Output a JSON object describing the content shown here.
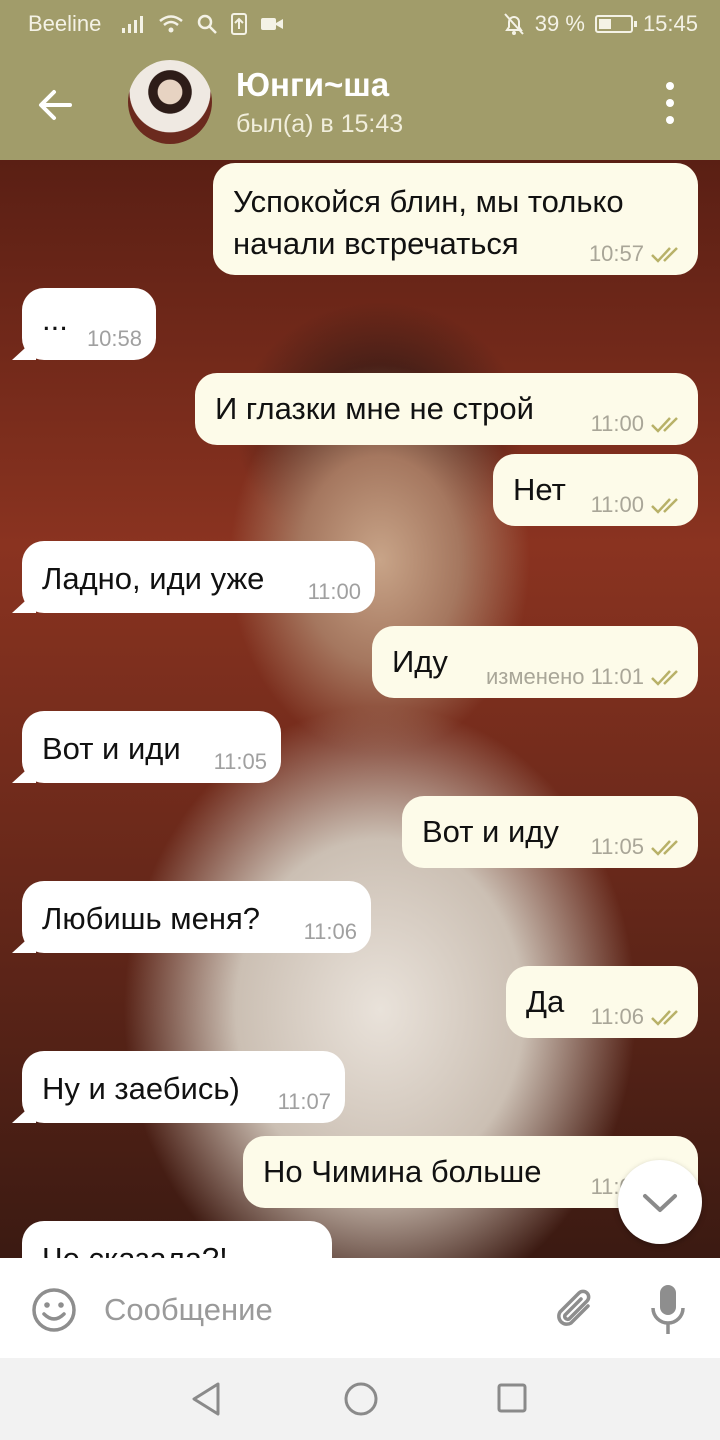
{
  "status_bar": {
    "carrier": "Beeline",
    "battery": "39 %",
    "battery_level": 0.39,
    "time": "15:45"
  },
  "header": {
    "contact_name": "Юнги~ша",
    "last_seen": "был(а) в 15:43"
  },
  "messages": [
    {
      "dir": "out",
      "text": "Успокойся блин, мы только начали встречаться",
      "time": "10:57",
      "read": true
    },
    {
      "dir": "in",
      "text": "...",
      "time": "10:58"
    },
    {
      "dir": "out",
      "text": "И глазки мне не строй",
      "time": "11:00",
      "read": true
    },
    {
      "dir": "out",
      "text": "Нет",
      "time": "11:00",
      "read": true
    },
    {
      "dir": "in",
      "text": "Ладно, иди уже",
      "time": "11:00"
    },
    {
      "dir": "out",
      "text": "Иду",
      "time": "изменено 11:01",
      "read": true
    },
    {
      "dir": "in",
      "text": "Вот и иди",
      "time": "11:05"
    },
    {
      "dir": "out",
      "text": "Вот и иду",
      "time": "11:05",
      "read": true
    },
    {
      "dir": "in",
      "text": "Любишь меня?",
      "time": "11:06"
    },
    {
      "dir": "out",
      "text": "Да",
      "time": "11:06",
      "read": true
    },
    {
      "dir": "in",
      "text": "Ну и заебись)",
      "time": "11:07"
    },
    {
      "dir": "out",
      "text": "Но Чимина больше",
      "time": "11:07",
      "read": true
    },
    {
      "dir": "in",
      "text": "Че сказала?!",
      "time": ""
    }
  ],
  "input": {
    "placeholder": "Сообщение"
  },
  "colors": {
    "header": "#a19c6a",
    "bubble_out": "#fdfbe9",
    "bubble_in": "#ffffff",
    "read_ticks": "#b8b168"
  },
  "icons": [
    "back-arrow-icon",
    "more-vert-icon",
    "emoji-icon",
    "attach-icon",
    "mic-icon",
    "chevron-down-icon",
    "nav-back-icon",
    "nav-home-icon",
    "nav-recent-icon"
  ]
}
